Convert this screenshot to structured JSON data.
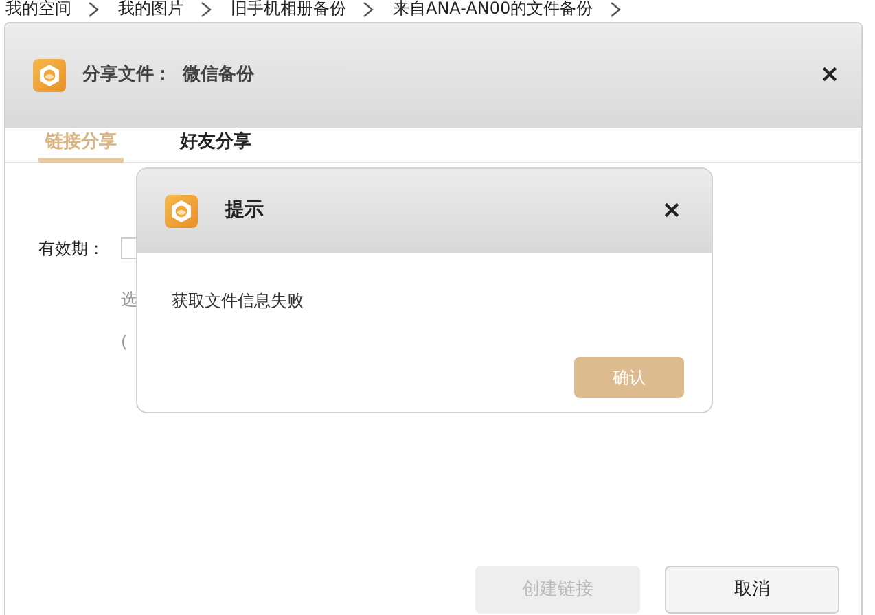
{
  "breadcrumb": [
    {
      "label": "我的空间"
    },
    {
      "label": "我的图片"
    },
    {
      "label": "旧手机相册备份"
    },
    {
      "label": "来自ANA-AN00的文件备份"
    }
  ],
  "dialog": {
    "title": "分享文件：",
    "file_name": "微信备份",
    "tabs": [
      {
        "label": "链接分享",
        "selected": true
      },
      {
        "label": "好友分享",
        "selected": false
      }
    ],
    "expiry_label": "有效期：",
    "hint_lines": [
      "选",
      "("
    ],
    "buttons": [
      {
        "label": "创建链接",
        "disabled": true
      },
      {
        "label": "取消",
        "disabled": false
      }
    ]
  },
  "alert": {
    "title": "提示",
    "message": "获取文件信息失败",
    "button": "确认"
  }
}
